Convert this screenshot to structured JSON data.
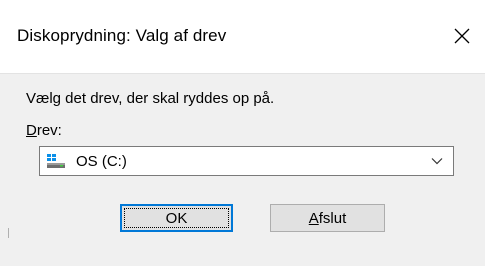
{
  "window": {
    "title": "Diskoprydning: Valg af drev"
  },
  "dialog": {
    "prompt": "Vælg det drev, der skal ryddes op på.",
    "drive_label_accel": "D",
    "drive_label_rest": "rev:",
    "drive_select_value": "OS (C:)",
    "ok_label": "OK",
    "exit_accel": "A",
    "exit_rest": "fslut"
  },
  "icons": {
    "close": "close-icon",
    "drive": "windows-drive-icon",
    "dropdown": "chevron-down-icon"
  },
  "colors": {
    "accent": "#0078d7",
    "dialog_bg": "#f0f0f0"
  }
}
